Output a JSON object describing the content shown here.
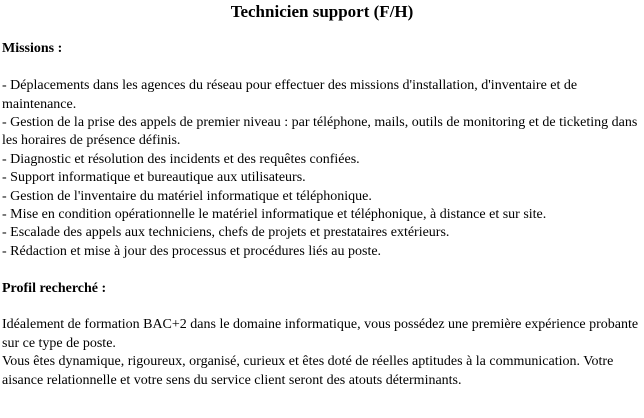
{
  "title": "Technicien support (F/H)",
  "missions": {
    "heading": "Missions :",
    "items": [
      "- Déplacements dans les agences du réseau pour effectuer des missions d'installation, d'inventaire et de maintenance.",
      "- Gestion de la prise des appels de premier niveau : par téléphone, mails, outils de monitoring et de ticketing dans les horaires de présence définis.",
      "- Diagnostic et résolution des incidents et des requêtes confiées.",
      "- Support informatique et bureautique aux utilisateurs.",
      "- Gestion de l'inventaire du matériel informatique et téléphonique.",
      "- Mise en condition opérationnelle le matériel informatique et téléphonique, à distance et sur site.",
      "- Escalade des appels aux techniciens, chefs de projets et prestataires extérieurs.",
      "- Rédaction et mise à jour des processus et procédures liés au poste."
    ]
  },
  "profil": {
    "heading": "Profil recherché :",
    "paragraphs": [
      "Idéalement de formation BAC+2 dans le domaine informatique, vous possédez une première expérience probante sur ce type de poste.",
      "Vous êtes dynamique, rigoureux, organisé, curieux et êtes doté de réelles aptitudes à la communication. Votre aisance relationnelle et votre sens du service client seront des atouts déterminants."
    ]
  }
}
